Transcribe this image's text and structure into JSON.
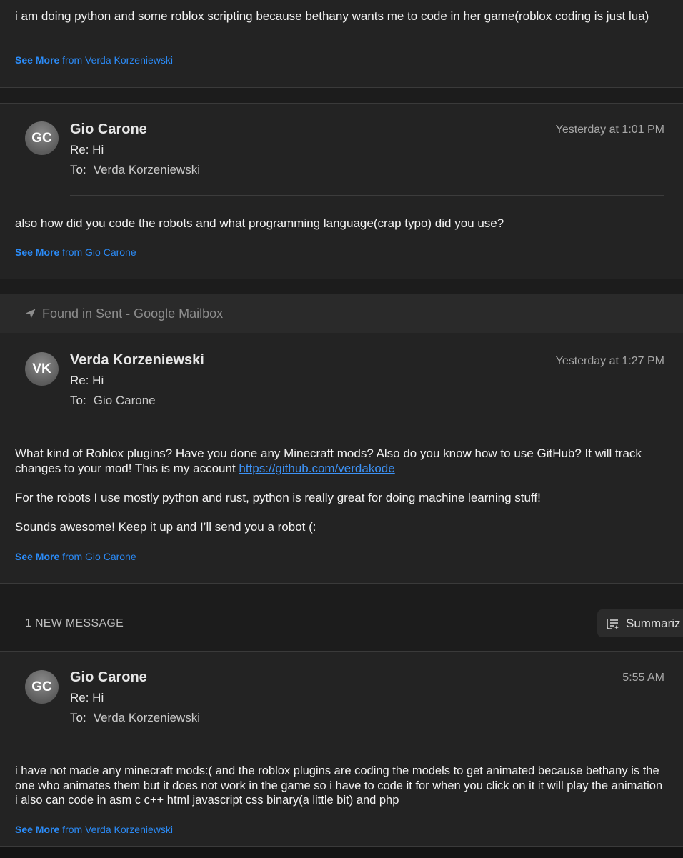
{
  "messages": [
    {
      "body": [
        "i am doing python and some roblox scripting because bethany wants me to code in her game(roblox coding is just lua)"
      ],
      "see_more": "See More",
      "from_text": "from Verda Korzeniewski"
    },
    {
      "avatar": "GC",
      "sender": "Gio Carone",
      "subject": "Re: Hi",
      "to_label": "To:",
      "to": "Verda Korzeniewski",
      "time": "Yesterday at 1:01 PM",
      "body": [
        "also how did you code the robots and what programming language(crap typo) did you use?"
      ],
      "see_more": "See More",
      "from_text": "from Gio Carone"
    },
    {
      "found_in": "Found in Sent - Google Mailbox",
      "avatar": "VK",
      "sender": "Verda Korzeniewski",
      "subject": "Re: Hi",
      "to_label": "To:",
      "to": "Gio Carone",
      "time": "Yesterday at 1:27 PM",
      "body_p1": "What kind of Roblox plugins? Have you done any Minecraft mods? Also do you know how to use GitHub? It will track changes to your mod! This is my account",
      "body_link": "https://github.com/verdakode",
      "body_p2": "For the robots I use mostly python and rust, python is really great for doing machine learning stuff!",
      "body_p3": "Sounds awesome! Keep it up and I’ll send you a robot (:",
      "see_more": "See More",
      "from_text": "from Gio Carone"
    },
    {
      "avatar": "GC",
      "sender": "Gio Carone",
      "subject": "Re: Hi",
      "to_label": "To:",
      "to": "Verda Korzeniewski",
      "time": "5:55 AM",
      "body": [
        "i have not made any minecraft mods:( and the roblox plugins are coding the models to get animated because bethany is the one who animates them but it does not work in the game so i have to code it for when you click on it it will play the animation i also can code in asm  c c++ html javascript css binary(a little bit) and php"
      ],
      "see_more": "See More",
      "from_text": "from Verda Korzeniewski"
    }
  ],
  "new_message_divider": {
    "label": "1 NEW MESSAGE",
    "summarize_button": "Summariz"
  },
  "icons": {
    "found_icon": "location-arrow-icon",
    "summarize_icon": "summary-lines-icon"
  },
  "colors": {
    "link": "#2b8bf7",
    "background": "#232323"
  }
}
